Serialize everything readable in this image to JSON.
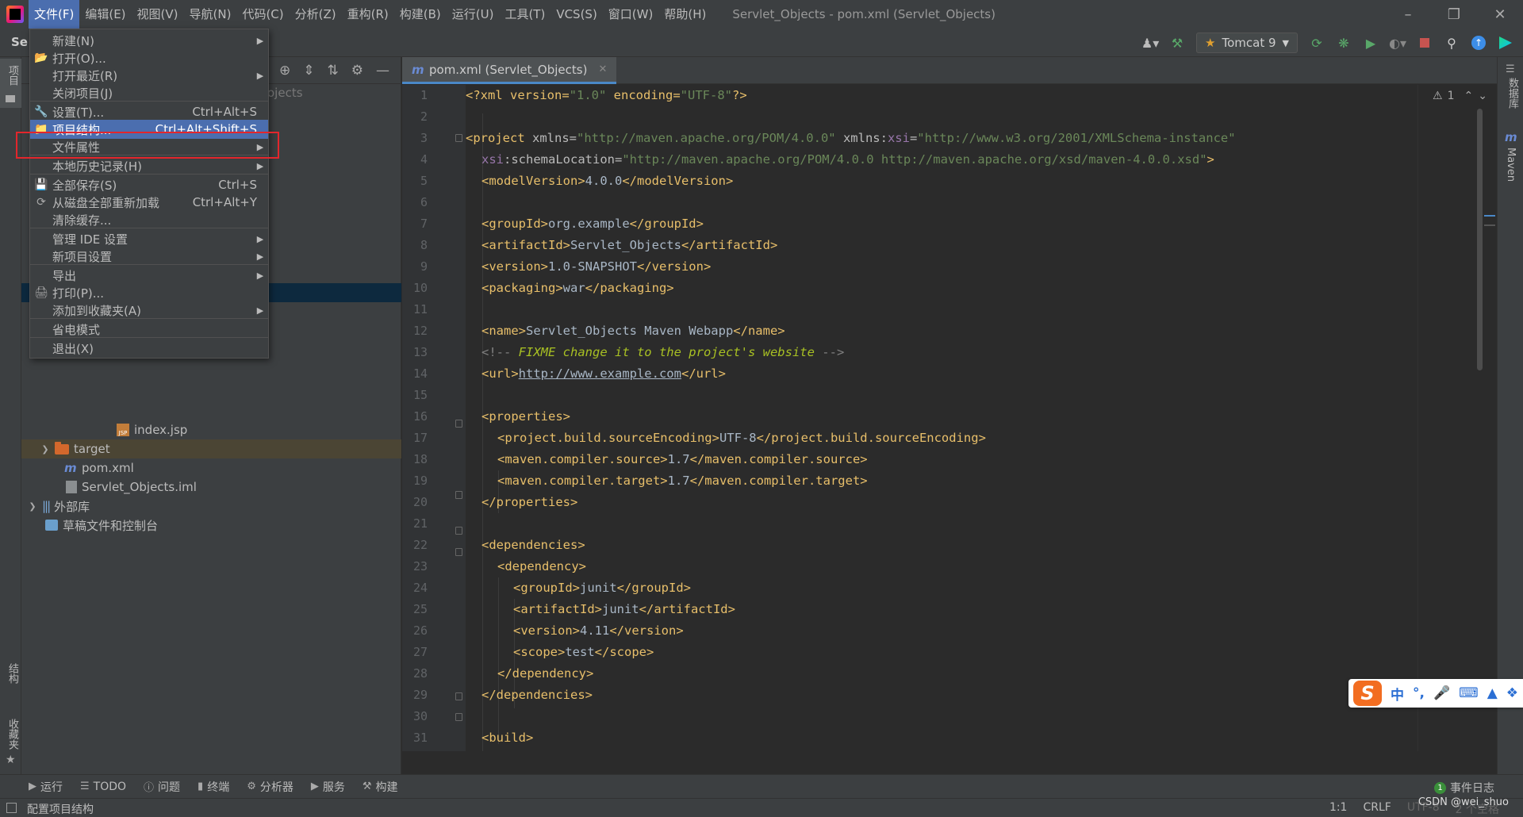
{
  "menubar": {
    "items": [
      "文件(F)",
      "编辑(E)",
      "视图(V)",
      "导航(N)",
      "代码(C)",
      "分析(Z)",
      "重构(R)",
      "构建(B)",
      "运行(U)",
      "工具(T)",
      "VCS(S)",
      "窗口(W)",
      "帮助(H)"
    ],
    "window_title": "Servlet_Objects - pom.xml (Servlet_Objects)"
  },
  "toolbar": {
    "project_short": "Se",
    "run_config": "Tomcat 9"
  },
  "left_strip": {
    "project": "项目",
    "structure": "结构",
    "favorites": "收藏夹"
  },
  "right_strip": {
    "database": "数据库",
    "maven": "Maven"
  },
  "file_menu": {
    "items": [
      {
        "label": "新建(N)",
        "shortcut": "",
        "submenu": true
      },
      {
        "label": "打开(O)...",
        "shortcut": "",
        "submenu": false
      },
      {
        "label": "打开最近(R)",
        "shortcut": "",
        "submenu": true
      },
      {
        "label": "关闭项目(J)",
        "shortcut": "",
        "submenu": false
      },
      {
        "label": "设置(T)...",
        "shortcut": "Ctrl+Alt+S",
        "submenu": false
      },
      {
        "label": "项目结构...",
        "shortcut": "Ctrl+Alt+Shift+S",
        "submenu": false
      },
      {
        "label": "文件属性",
        "shortcut": "",
        "submenu": true
      },
      {
        "label": "本地历史记录(H)",
        "shortcut": "",
        "submenu": true
      },
      {
        "label": "全部保存(S)",
        "shortcut": "Ctrl+S",
        "submenu": false
      },
      {
        "label": "从磁盘全部重新加载",
        "shortcut": "Ctrl+Alt+Y",
        "submenu": false
      },
      {
        "label": "清除缓存...",
        "shortcut": "",
        "submenu": false
      },
      {
        "label": "管理 IDE 设置",
        "shortcut": "",
        "submenu": true
      },
      {
        "label": "新项目设置",
        "shortcut": "",
        "submenu": true
      },
      {
        "label": "导出",
        "shortcut": "",
        "submenu": true
      },
      {
        "label": "打印(P)...",
        "shortcut": "",
        "submenu": false
      },
      {
        "label": "添加到收藏夹(A)",
        "shortcut": "",
        "submenu": true
      },
      {
        "label": "省电模式",
        "shortcut": "",
        "submenu": false
      },
      {
        "label": "退出(X)",
        "shortcut": "",
        "submenu": false
      }
    ],
    "selected": "项目结构..."
  },
  "project_tree": {
    "crumb": "ojects",
    "index_jsp": "index.jsp",
    "target": "target",
    "pom": "pom.xml",
    "iml": "Servlet_Objects.iml",
    "external_libs": "外部库",
    "scratches": "草稿文件和控制台"
  },
  "editor": {
    "tab": "pom.xml (Servlet_Objects)",
    "warnings": "1",
    "line_numbers": [
      "1",
      "2",
      "3",
      "4",
      "5",
      "6",
      "7",
      "8",
      "9",
      "10",
      "11",
      "12",
      "13",
      "14",
      "15",
      "16",
      "17",
      "18",
      "19",
      "20",
      "21",
      "22",
      "23",
      "24",
      "25",
      "26",
      "27",
      "28",
      "29",
      "30",
      "31"
    ],
    "code": {
      "l1_a": "<?xml version=",
      "l1_b": "\"1.0\"",
      "l1_c": " encoding=",
      "l1_d": "\"UTF-8\"",
      "l1_e": "?>",
      "l3_a": "<project ",
      "l3_b": "xmlns=",
      "l3_c": "\"http://maven.apache.org/POM/4.0.0\"",
      "l3_d": " xmlns:",
      "l3_e": "xsi",
      "l3_f": "=",
      "l3_g": "\"http://www.w3.org/2001/XMLSchema-instance\"",
      "l4_a": "xsi",
      "l4_b": ":schemaLocation=",
      "l4_c": "\"http://maven.apache.org/POM/4.0.0 http://maven.apache.org/xsd/maven-4.0.0.xsd\"",
      "l4_d": ">",
      "l5_a": "<modelVersion>",
      "l5_b": "4.0.0",
      "l5_c": "</modelVersion>",
      "l7_a": "<groupId>",
      "l7_b": "org.example",
      "l7_c": "</groupId>",
      "l8_a": "<artifactId>",
      "l8_b": "Servlet_Objects",
      "l8_c": "</artifactId>",
      "l9_a": "<version>",
      "l9_b": "1.0-SNAPSHOT",
      "l9_c": "</version>",
      "l10_a": "<packaging>",
      "l10_b": "war",
      "l10_c": "</packaging>",
      "l12_a": "<name>",
      "l12_b": "Servlet_Objects Maven Webapp",
      "l12_c": "</name>",
      "l13_a": "<!-- ",
      "l13_b": "FIXME change it to the project's website",
      "l13_c": " -->",
      "l14_a": "<url>",
      "l14_b": "http://www.example.com",
      "l14_c": "</url>",
      "l16": "<properties>",
      "l17_a": "<project.build.sourceEncoding>",
      "l17_b": "UTF-8",
      "l17_c": "</project.build.sourceEncoding>",
      "l18_a": "<maven.compiler.source>",
      "l18_b": "1.7",
      "l18_c": "</maven.compiler.source>",
      "l19_a": "<maven.compiler.target>",
      "l19_b": "1.7",
      "l19_c": "</maven.compiler.target>",
      "l20": "</properties>",
      "l22": "<dependencies>",
      "l23": "<dependency>",
      "l24_a": "<groupId>",
      "l24_b": "junit",
      "l24_c": "</groupId>",
      "l25_a": "<artifactId>",
      "l25_b": "junit",
      "l25_c": "</artifactId>",
      "l26_a": "<version>",
      "l26_b": "4.11",
      "l26_c": "</version>",
      "l27_a": "<scope>",
      "l27_b": "test",
      "l27_c": "</scope>",
      "l28": "</dependency>",
      "l29": "</dependencies>",
      "l31": "<build>"
    }
  },
  "bottom_tools": [
    "运行",
    "TODO",
    "问题",
    "终端",
    "分析器",
    "服务",
    "构建"
  ],
  "event_log": {
    "count": "1",
    "label": "事件日志"
  },
  "status": {
    "left": "配置项目结构",
    "position": "1:1",
    "line_sep": "CRLF",
    "encoding": "UTF-8",
    "indent": "2 个空格"
  },
  "watermark": "CSDN @wei_shuo",
  "ime": {
    "logo": "S",
    "lang": "中",
    "punct": "°,"
  },
  "colors": {
    "menu_selected": "#4b6eaf",
    "highlight_box": "#e3262c",
    "xml_tag": "#e8bf6a",
    "xml_string": "#6a8759",
    "xml_text": "#a9b7c6",
    "ime_accent": "#f26d21"
  }
}
